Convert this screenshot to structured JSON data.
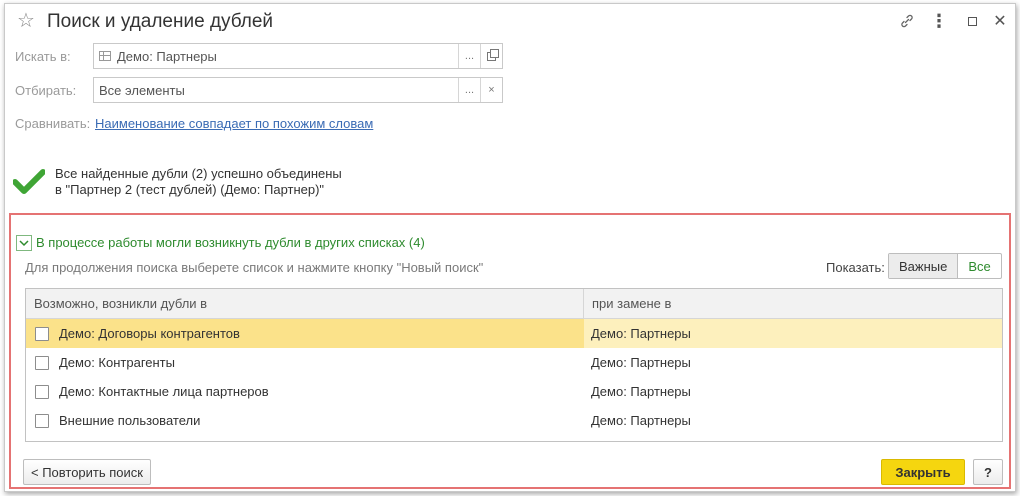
{
  "window": {
    "title": "Поиск и удаление дублей",
    "icons": [
      "star-icon",
      "link-icon",
      "more-icon",
      "maximize-icon",
      "close-icon"
    ]
  },
  "form": {
    "search_in_label": "Искать в:",
    "search_in_value": "Демо: Партнеры",
    "search_in_btn1": "...",
    "filter_label": "Отбирать:",
    "filter_value": "Все элементы",
    "filter_btn1": "...",
    "filter_btn2": "×",
    "compare_label": "Сравнивать:",
    "compare_link": "Наименование совпадает по похожим словам"
  },
  "result": {
    "line1": "Все найденные дубли (2) успешно объединены",
    "line2": "в \"Партнер 2 (тест дублей) (Демо: Партнер)\"",
    "color": "#3fa535"
  },
  "group": {
    "title": "В процессе работы могли возникнуть дубли в других списках (4)",
    "hint": "Для продолжения поиска выберете список и нажмите кнопку \"Новый поиск\"",
    "show_label": "Показать:",
    "filter_important": "Важные",
    "filter_all": "Все",
    "columns": [
      "Возможно, возникли дубли в",
      "при замене в"
    ],
    "rows": [
      {
        "name": "Демо: Договоры контрагентов",
        "replace": "Демо: Партнеры",
        "checked": false,
        "selected": true
      },
      {
        "name": "Демо: Контрагенты",
        "replace": "Демо: Партнеры",
        "checked": false,
        "selected": false
      },
      {
        "name": "Демо: Контактные лица партнеров",
        "replace": "Демо: Партнеры",
        "checked": false,
        "selected": false
      },
      {
        "name": "Внешние пользователи",
        "replace": "Демо: Партнеры",
        "checked": false,
        "selected": false
      }
    ]
  },
  "buttons": {
    "repeat": "< Повторить поиск",
    "close": "Закрыть",
    "help": "?"
  },
  "colors": {
    "accent_yellow": "#f5d60f",
    "selected_row": "#fbe28a",
    "highlight_border": "#e57373",
    "green_text": "#2e8b2e",
    "link_blue": "#3a6bb4"
  }
}
